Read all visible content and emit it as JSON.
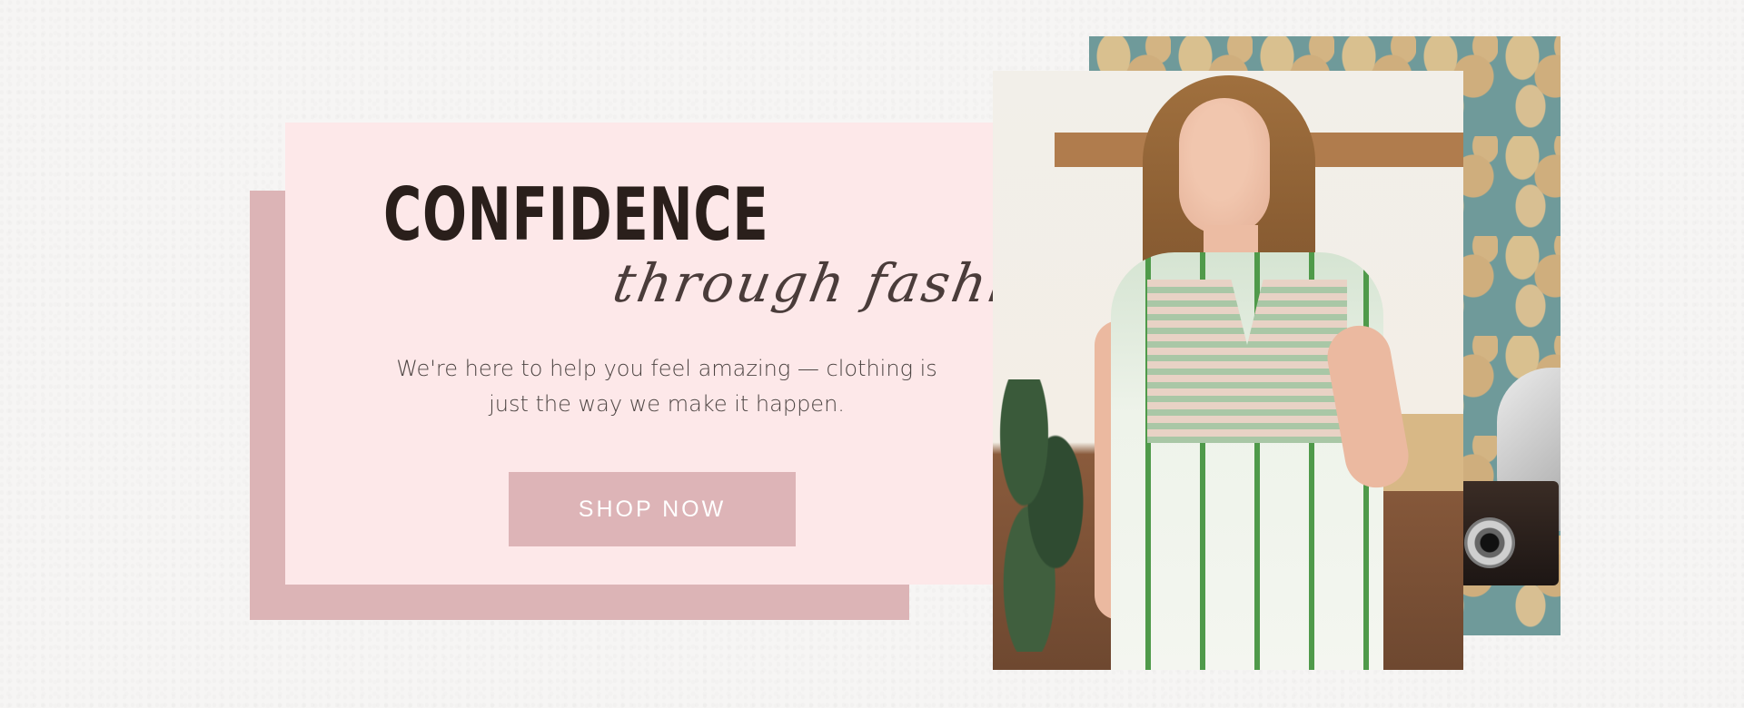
{
  "hero": {
    "headline": "CONFIDENCE",
    "script_line": "through fashion",
    "tagline": "We're here to help you feel amazing — clothing is just the way we make it happen.",
    "cta_label": "SHOP NOW"
  },
  "colors": {
    "page_background": "#f6f5f4",
    "card_background": "#fde8e9",
    "shadow_panel": "#dcb4b6",
    "button": "#ddb4b7",
    "headline_text": "#2a1f1b"
  },
  "images": {
    "main_photo": "woman-in-green-floral-dress-photo",
    "background_photo": "teal-floral-wallpaper-with-vintage-camera-photo"
  }
}
